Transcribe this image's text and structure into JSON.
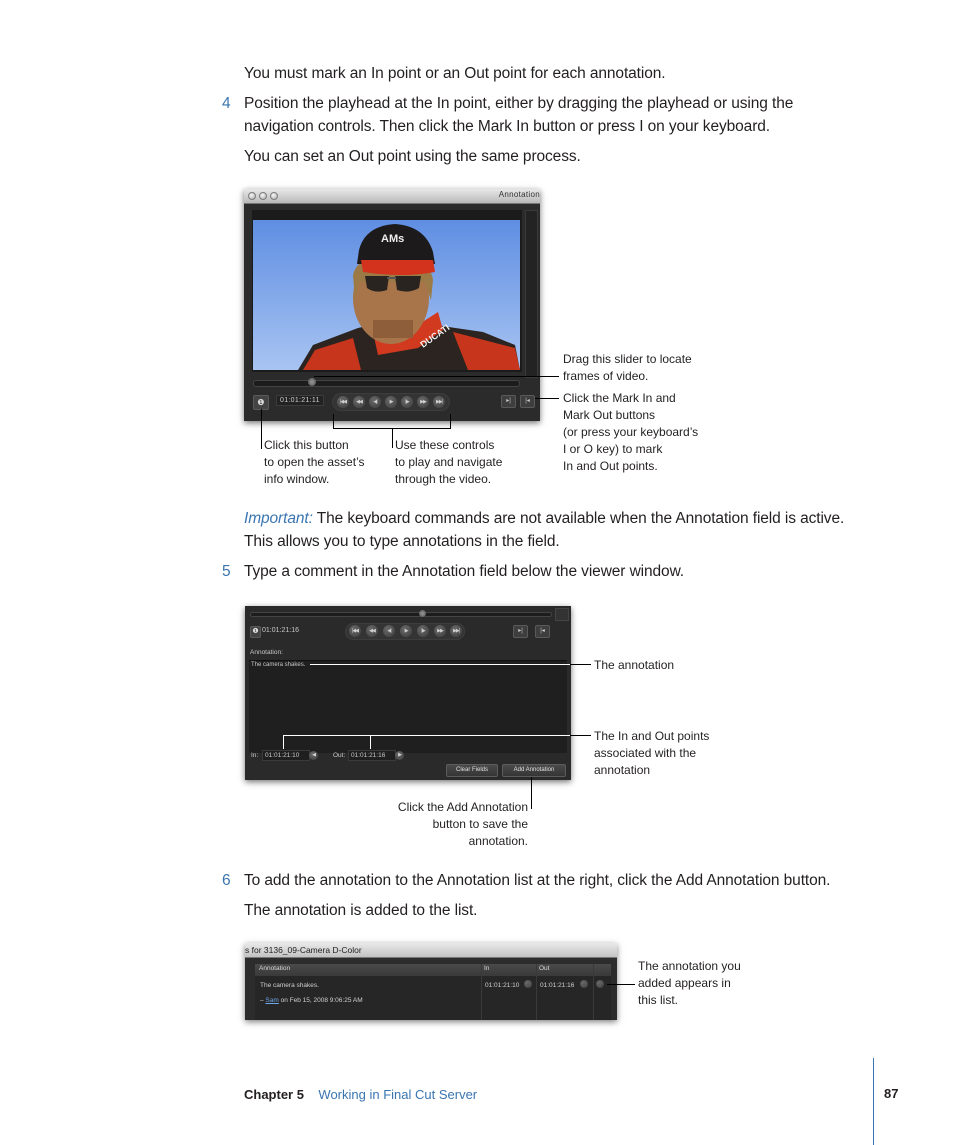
{
  "paragraphs": {
    "p1": "You must mark an In point or an Out point for each annotation.",
    "step4_num": "4",
    "step4_line1": "Position the playhead at the In point, either by dragging the playhead or using the",
    "step4_line2": "navigation controls. Then click the Mark In button or press I on your keyboard.",
    "p2": "You can set an Out point using the same process.",
    "important_label": "Important:",
    "important_line1": " The keyboard commands are not available when the Annotation field is active.",
    "important_line2": "This allows you to type annotations in the field.",
    "step5_num": "5",
    "step5_text": "Type a comment in the Annotation field below the viewer window.",
    "step6_num": "6",
    "step6_text": "To add the annotation to the Annotation list at the right, click the Add Annotation button.",
    "p3": "The annotation is added to the list."
  },
  "figure1": {
    "window_title": "Annotation",
    "timecode": "01:01:21:11",
    "scrub_position": 0.22,
    "transport_buttons": [
      "go-to-start",
      "rewind",
      "step-back",
      "play",
      "step-forward",
      "fast-forward",
      "go-to-end"
    ],
    "transport_glyphs": [
      "|◀◀",
      "◀◀",
      "◀|",
      "▶",
      "|▶",
      "▶▶",
      "▶▶|"
    ],
    "mark_in_glyph": "▸|",
    "mark_out_glyph": "|◂",
    "info_glyph": "❶",
    "callouts": {
      "slider": [
        "Drag this slider to locate",
        "frames of video."
      ],
      "mark": [
        "Click the Mark In and",
        "Mark Out buttons",
        "(or press your keyboard’s",
        "I or O key) to mark",
        "In and Out points."
      ],
      "info": [
        "Click this button",
        "to open the asset’s",
        "info window."
      ],
      "controls": [
        "Use these controls",
        "to play and navigate",
        "through the video."
      ]
    }
  },
  "figure2": {
    "timecode": "01:01:21:16",
    "scrub_position": 0.57,
    "annotation_label": "Annotation:",
    "annotation_text": "The camera shakes.",
    "in_label": "In:",
    "in_value": "01:01:21:10",
    "out_label": "Out:",
    "out_value": "01:01:21:16",
    "clear_button": "Clear Fields",
    "add_button": "Add Annotation",
    "callouts": {
      "annotation": "The annotation",
      "inout": [
        "The In and Out points",
        "associated with the",
        "annotation"
      ],
      "add": [
        "Click the Add Annotation",
        "button to save the",
        "annotation."
      ]
    }
  },
  "figure3": {
    "window_title": "s for 3136_09-Camera D-Color",
    "columns": [
      "Annotation",
      "In",
      "Out"
    ],
    "rows": [
      {
        "annotation": "The camera shakes.",
        "author_prefix": "– ",
        "author": "Sam",
        "date": " on Feb 15, 2008 9:06:25 AM",
        "in": "01:01:21:10",
        "out": "01:01:21:16"
      }
    ],
    "callout": [
      "The annotation you",
      "added appears in",
      "this list."
    ]
  },
  "footer": {
    "chapter": "Chapter 5",
    "title": "Working in Final Cut Server",
    "page": "87"
  },
  "colors": {
    "accent_blue": "#3a75b0",
    "text": "#231f20"
  }
}
